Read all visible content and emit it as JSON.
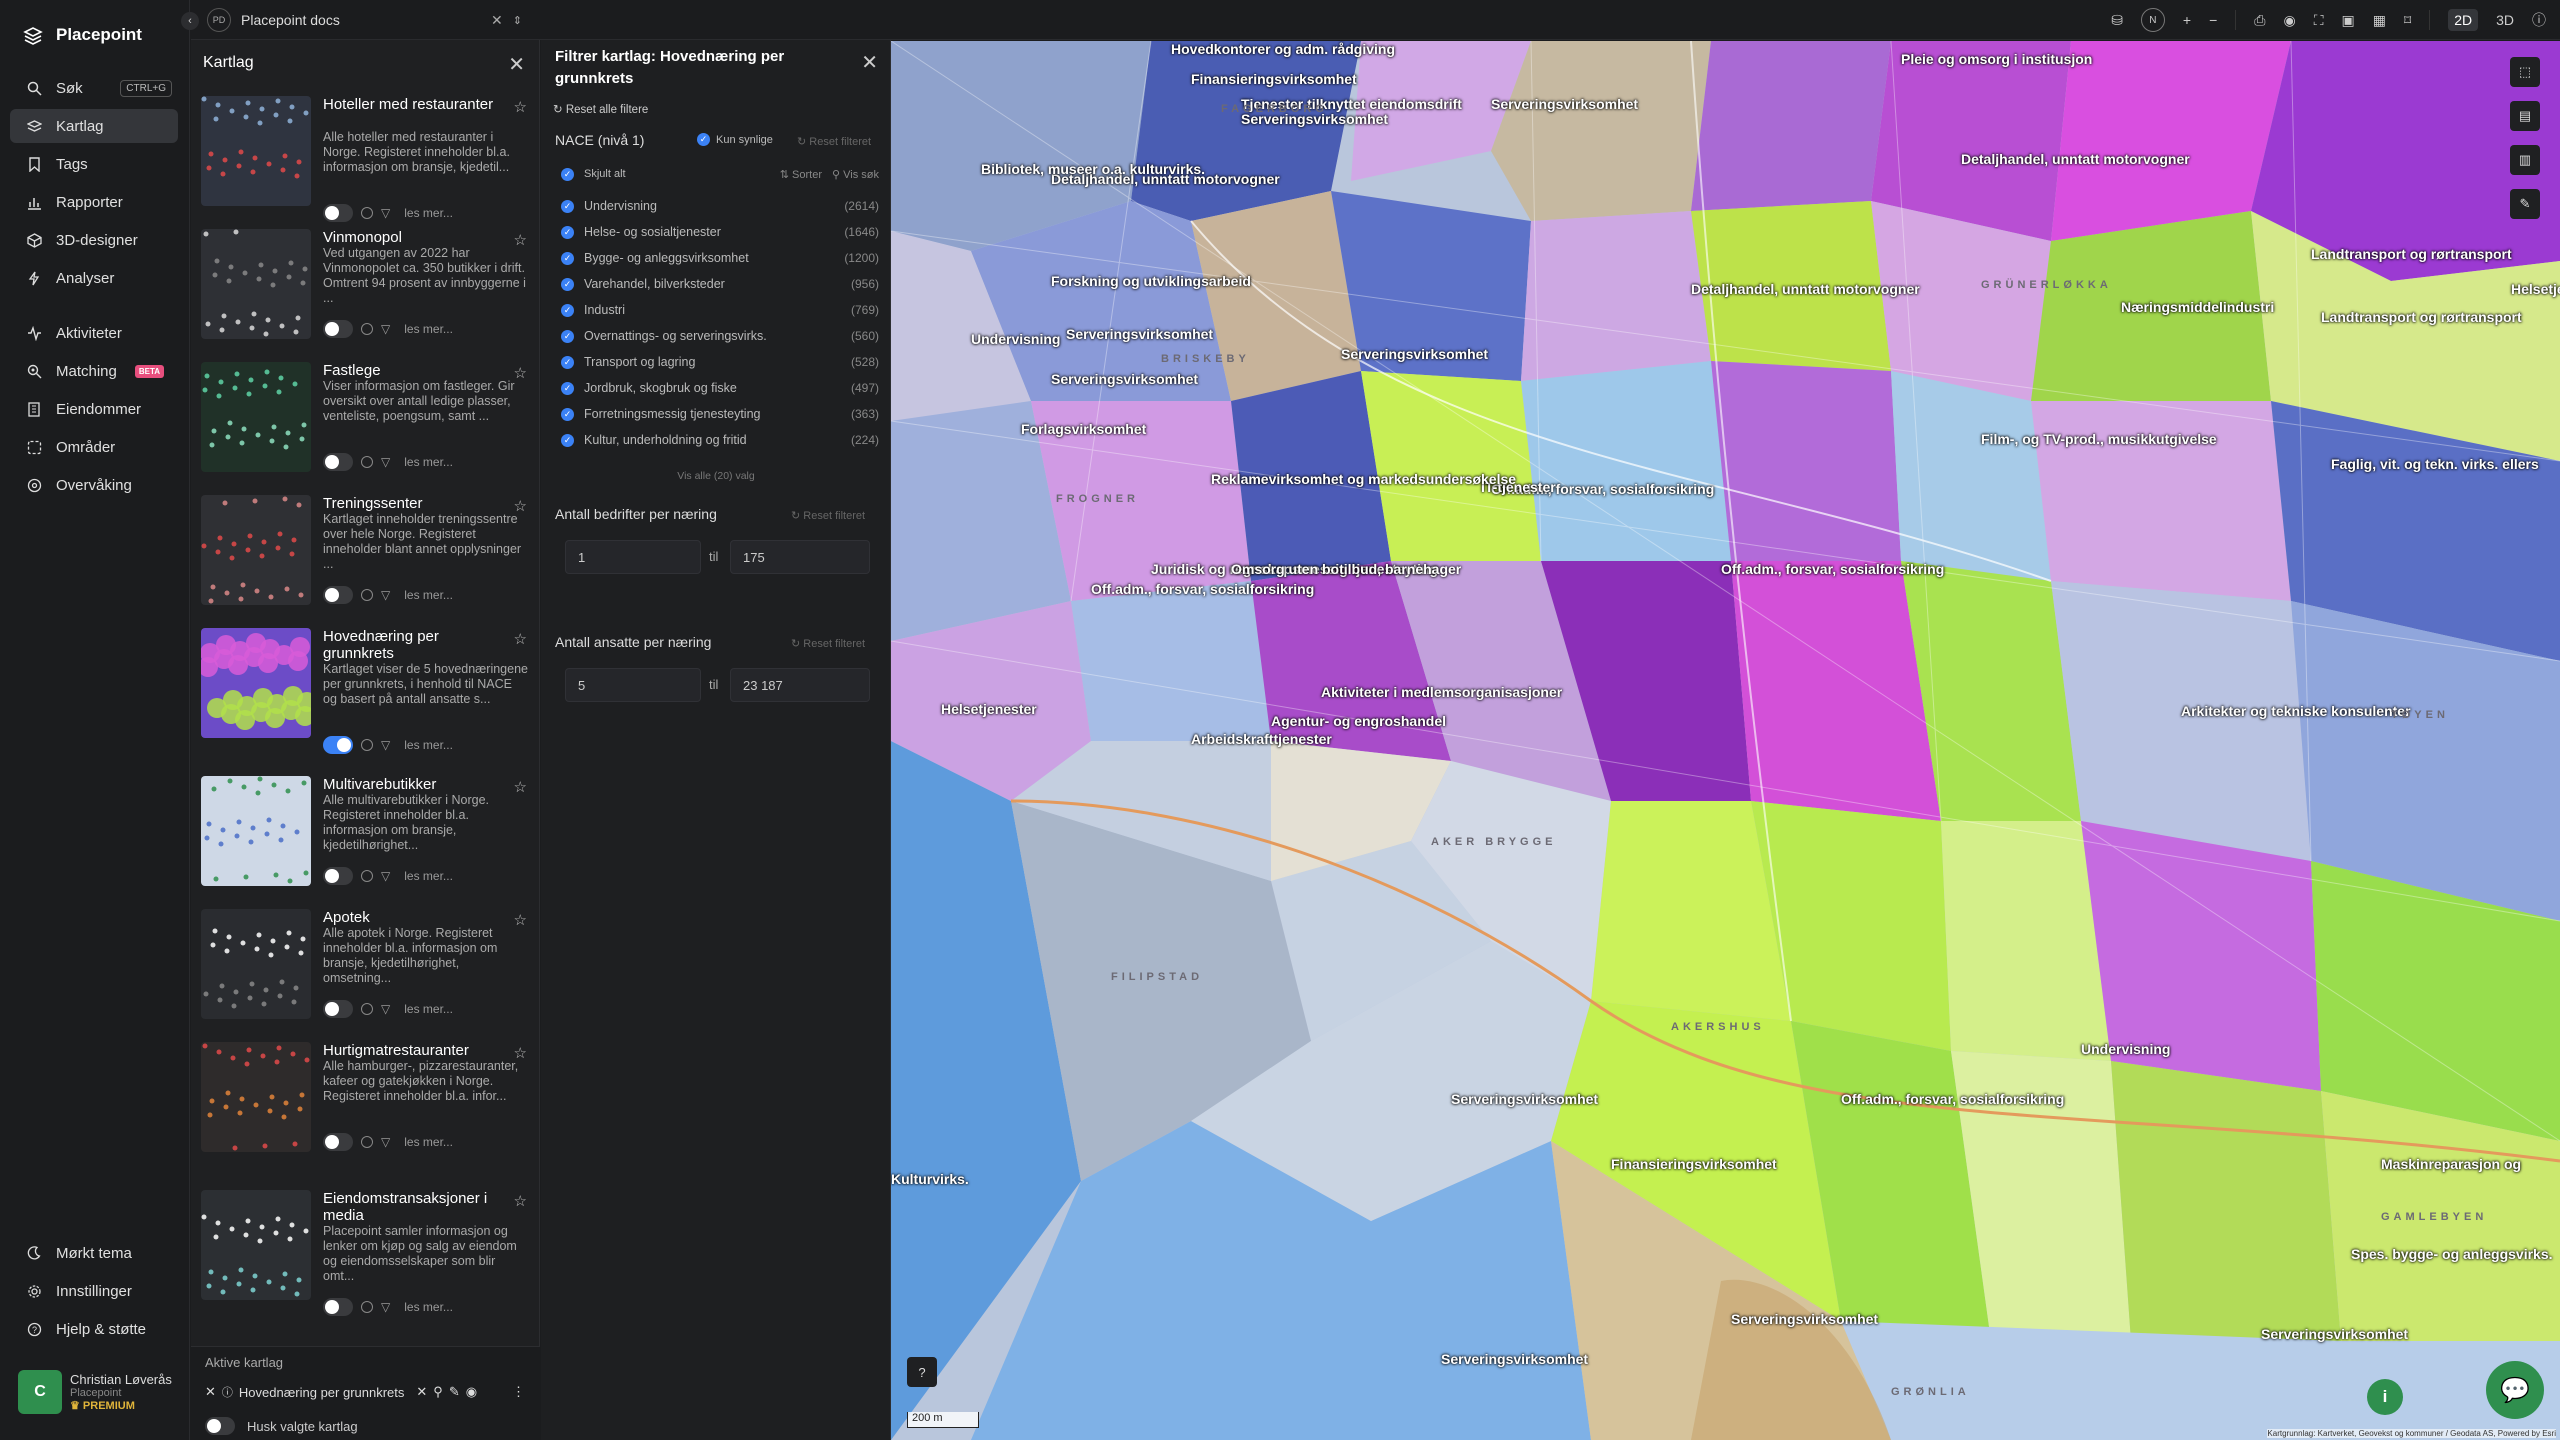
{
  "brand": {
    "name": "Placepoint"
  },
  "nav": {
    "items": [
      {
        "label": "Søk",
        "icon": "search-icon",
        "kbd": "CTRL+G"
      },
      {
        "label": "Kartlag",
        "icon": "layers-icon",
        "active": true
      },
      {
        "label": "Tags",
        "icon": "bookmark-icon"
      },
      {
        "label": "Rapporter",
        "icon": "chart-icon"
      },
      {
        "label": "3D-designer",
        "icon": "cube-icon"
      },
      {
        "label": "Analyser",
        "icon": "bolt-icon"
      },
      {
        "label": "Aktiviteter",
        "icon": "activity-icon"
      },
      {
        "label": "Matching",
        "icon": "match-icon",
        "badge": "BETA"
      },
      {
        "label": "Eiendommer",
        "icon": "building-icon"
      },
      {
        "label": "Områder",
        "icon": "area-icon"
      },
      {
        "label": "Overvåking",
        "icon": "monitor-icon"
      }
    ],
    "bottom": [
      {
        "label": "Mørkt tema",
        "icon": "moon-icon"
      },
      {
        "label": "Innstillinger",
        "icon": "gear-icon"
      },
      {
        "label": "Hjelp & støtte",
        "icon": "help-icon"
      }
    ],
    "user": {
      "initial": "C",
      "name": "Christian Løverås",
      "org": "Placepoint",
      "plan": "PREMIUM"
    }
  },
  "topbar": {
    "doc": "Placepoint docs",
    "doc_badge": "PD",
    "north": "N",
    "mode_2d": "2D",
    "mode_3d": "3D"
  },
  "layers_panel": {
    "title": "Kartlag",
    "read_more": "les mer...",
    "layers": [
      {
        "title": "Hoteller med restauranter",
        "desc": "Alle hoteller med restauranter i Norge. Registeret inneholder bl.a. informasjon om bransje, kjedetil...",
        "on": false
      },
      {
        "title": "Vinmonopol",
        "desc": "Ved utgangen av 2022 har Vinmonopolet ca. 350 butikker i drift. Omtrent 94 prosent av innbyggerne i ...",
        "on": false
      },
      {
        "title": "Fastlege",
        "desc": "Viser informasjon om fastleger. Gir oversikt over antall ledige plasser, venteliste, poengsum, samt ...",
        "on": false
      },
      {
        "title": "Treningssenter",
        "desc": "Kartlaget inneholder treningssentre over hele Norge. Registeret inneholder blant annet opplysninger ...",
        "on": false
      },
      {
        "title": "Hovednæring per grunnkrets",
        "desc": "Kartlaget viser de 5 hovednæringene per grunnkrets, i henhold til NACE og basert på antall ansatte s...",
        "on": true
      },
      {
        "title": "Multivarebutikker",
        "desc": "Alle multivarebutikker i Norge. Registeret inneholder bl.a. informasjon om bransje, kjedetilhørighet...",
        "on": false
      },
      {
        "title": "Apotek",
        "desc": "Alle apotek i Norge. Registeret inneholder bl.a. informasjon om bransje, kjedetilhørighet, omsetning...",
        "on": false
      },
      {
        "title": "Hurtigmatrestauranter",
        "desc": "Alle hamburger-, pizzarestauranter, kafeer og gatekjøkken i Norge. Registeret inneholder bl.a. infor...",
        "on": false
      },
      {
        "title": "Eiendomstransaksjoner i media",
        "desc": "Placepoint samler informasjon og lenker om kjøp og salg av eiendom og eiendomsselskaper som blir omt...",
        "on": false
      }
    ],
    "active_header": "Aktive kartlag",
    "active_layer": "Hovednæring per grunnkrets",
    "remember": "Husk valgte kartlag"
  },
  "filter_panel": {
    "title": "Filtrer kartlag: Hovednæring per grunnkrets",
    "reset_all": "Reset alle filtere",
    "nace_title": "NACE (nivå 1)",
    "only_visible": "Kun synlige",
    "reset_filter": "Reset filteret",
    "hide_all": "Skjult alt",
    "sort": "Sorter",
    "show_search": "Vis søk",
    "nace_items": [
      {
        "label": "Undervisning",
        "count": "(2614)"
      },
      {
        "label": "Helse- og sosialtjenester",
        "count": "(1646)"
      },
      {
        "label": "Bygge- og anleggsvirksomhet",
        "count": "(1200)"
      },
      {
        "label": "Varehandel, bilverksteder",
        "count": "(956)"
      },
      {
        "label": "Industri",
        "count": "(769)"
      },
      {
        "label": "Overnattings- og serveringsvirks.",
        "count": "(560)"
      },
      {
        "label": "Transport og lagring",
        "count": "(528)"
      },
      {
        "label": "Jordbruk, skogbruk og fiske",
        "count": "(497)"
      },
      {
        "label": "Forretningsmessig tjenesteyting",
        "count": "(363)"
      },
      {
        "label": "Kultur, underholdning og fritid",
        "count": "(224)"
      }
    ],
    "show_all": "Vis alle (20) valg",
    "companies_title": "Antall bedrifter per næring",
    "companies_from": "1",
    "companies_to": "175",
    "employees_title": "Antall ansatte per næring",
    "employees_from": "5",
    "employees_to": "23 187",
    "to_label": "til"
  },
  "map": {
    "scale": "200 m",
    "attribution": "Kartgrunnlag: Kartverket, Geovekst og kommuner / Geodata AS, Powered by Esri",
    "labels": [
      "Hovedkontorer og adm. rådgiving",
      "Finansieringsvirksomhet",
      "Serveringsvirksomhet",
      "Pleie og omsorg i institusjon",
      "Tjenester tilknyttet eiendomsdrift",
      "Detaljhandel, unntatt motorvogner",
      "Bibliotek, museer o.a. kulturvirks.",
      "Forskning og utviklingsarbeid",
      "Undervisning",
      "Næringsmiddelindustri",
      "Landtransport og rørtransport",
      "Helsetjenester",
      "Juridisk og regnskapsmessig tjenesteyting",
      "Film-, og TV-prod., musikkutgivelse",
      "Off.adm., forsvar, sosialforsikring",
      "IT-tjenester",
      "Reklamevirksomhet og markedsundersøkelse",
      "Omsorg uten botilbud, barnehager",
      "Aktiviteter i medlemsorganisasjoner",
      "Arbeidskrafttjenester",
      "Agentur- og engroshandel",
      "Arkitekter og tekniske konsulenter",
      "Maskinreparasjon og",
      "Spes. bygge- og anleggsvirks.",
      "Faglig, vit. og tekn. virks. ellers",
      "Forlagsvirksomhet",
      "Kulturvirks."
    ],
    "places": [
      "FROGNER",
      "BRISKEBY",
      "AKER BRYGGE",
      "FILIPSTAD",
      "AKERSHUS",
      "GRÜNERLØKKA",
      "TØYEN",
      "GAMLEBYEN",
      "GRØNLIA",
      "FAGERBORG"
    ]
  }
}
